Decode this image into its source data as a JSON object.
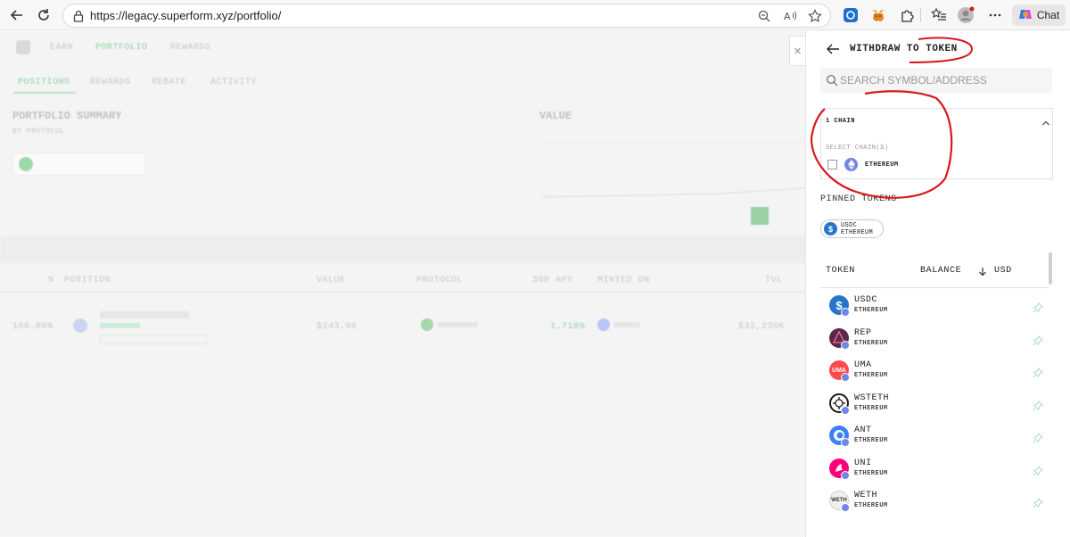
{
  "browser": {
    "url": "https://legacy.superform.xyz/portfolio/",
    "chat_label": "Chat"
  },
  "background_app": {
    "nav": [
      "EARN",
      "PORTFOLIO",
      "REWARDS"
    ],
    "tabs": [
      "POSITIONS",
      "REWARDS",
      "REBATE",
      "ACTIVITY"
    ],
    "summary_title": "PORTFOLIO SUMMARY",
    "summary_sub": "BY PROTOCOL",
    "value_title": "VALUE",
    "table_headers": [
      "%",
      "POSITION",
      "VALUE",
      "PROTOCOL",
      "30D APY",
      "MINTED ON",
      "TVL"
    ],
    "row": {
      "pct": "100.00%",
      "value": "$243.06",
      "apy": "1.718%",
      "tvl": "$32,230K"
    }
  },
  "drawer": {
    "title": "WITHDRAW TO TOKEN",
    "search_placeholder": "SEARCH SYMBOL/ADDRESS",
    "chain_count": "1 CHAIN",
    "select_chains_label": "SELECT CHAIN(S)",
    "chain_option": "ETHEREUM",
    "pinned_label": "PINNED TOKENS",
    "pinned": [
      {
        "symbol": "USDC",
        "chain": "ETHEREUM"
      }
    ],
    "headers": {
      "token": "TOKEN",
      "balance": "BALANCE",
      "usd": "USD"
    },
    "tokens": [
      {
        "symbol": "USDC",
        "chain": "ETHEREUM",
        "color": "#2775ca",
        "icon": "usdc-icon"
      },
      {
        "symbol": "REP",
        "chain": "ETHEREUM",
        "color": "#5a2a4e",
        "icon": "rep-icon"
      },
      {
        "symbol": "UMA",
        "chain": "ETHEREUM",
        "color": "#ff4a4a",
        "icon": "uma-icon"
      },
      {
        "symbol": "WSTETH",
        "chain": "ETHEREUM",
        "color": "#1a1a1a",
        "icon": "wsteth-icon"
      },
      {
        "symbol": "ANT",
        "chain": "ETHEREUM",
        "color": "#3b82f6",
        "icon": "ant-icon"
      },
      {
        "symbol": "UNI",
        "chain": "ETHEREUM",
        "color": "#ff007a",
        "icon": "uni-icon"
      },
      {
        "symbol": "WETH",
        "chain": "ETHEREUM",
        "color": "#e6e6e6",
        "icon": "weth-icon"
      }
    ]
  },
  "accent": "#d71920"
}
